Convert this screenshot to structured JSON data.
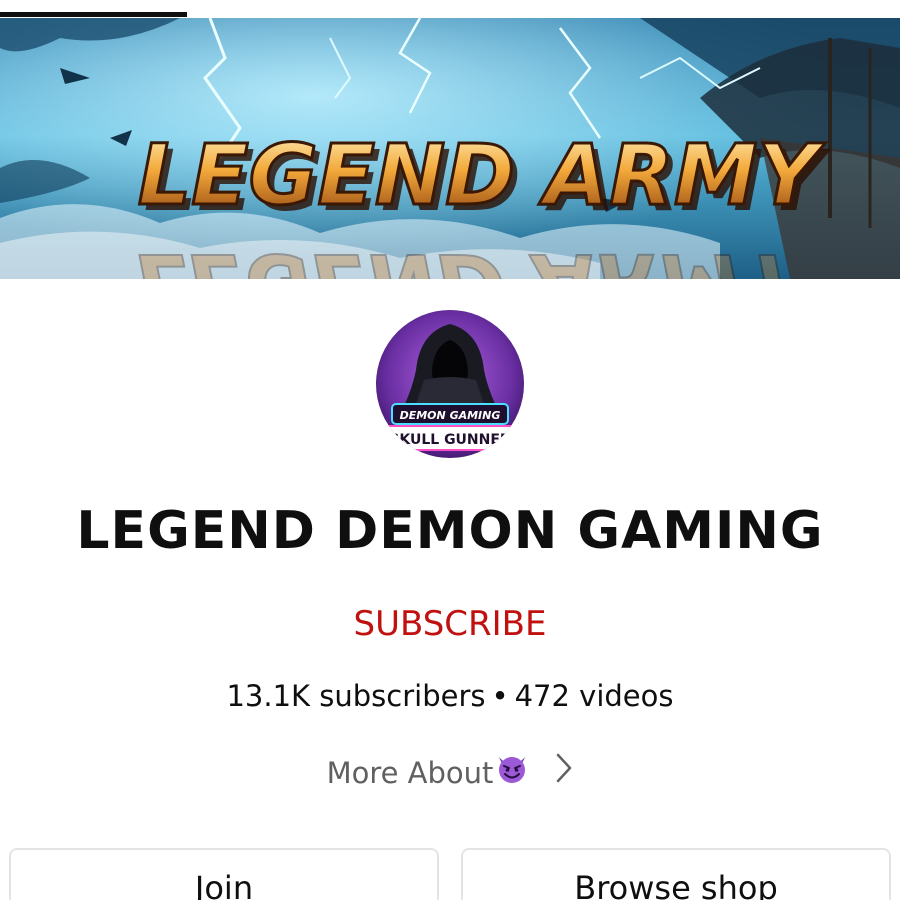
{
  "banner": {
    "title": "LEGEND ARMY"
  },
  "avatar": {
    "line1": "DEMON GAMING",
    "line2": "SKULL GUNNER"
  },
  "channel": {
    "name": "LEGEND DEMON GAMING",
    "subscribe_label": "SUBSCRIBE",
    "subscribers": "13.1K subscribers",
    "separator": "•",
    "videos": "472 videos",
    "more_about_label": "More About",
    "more_about_emoji": "smiling-devil-icon"
  },
  "actions": {
    "join_label": "Join",
    "shop_label": "Browse shop"
  },
  "colors": {
    "subscribe": "#c0110f",
    "text_primary": "#0f0f0f",
    "text_secondary": "#606060",
    "border": "#e4e4e4",
    "avatar_bg": "#6a2fa3",
    "banner_sky": "#3ea6d0"
  }
}
